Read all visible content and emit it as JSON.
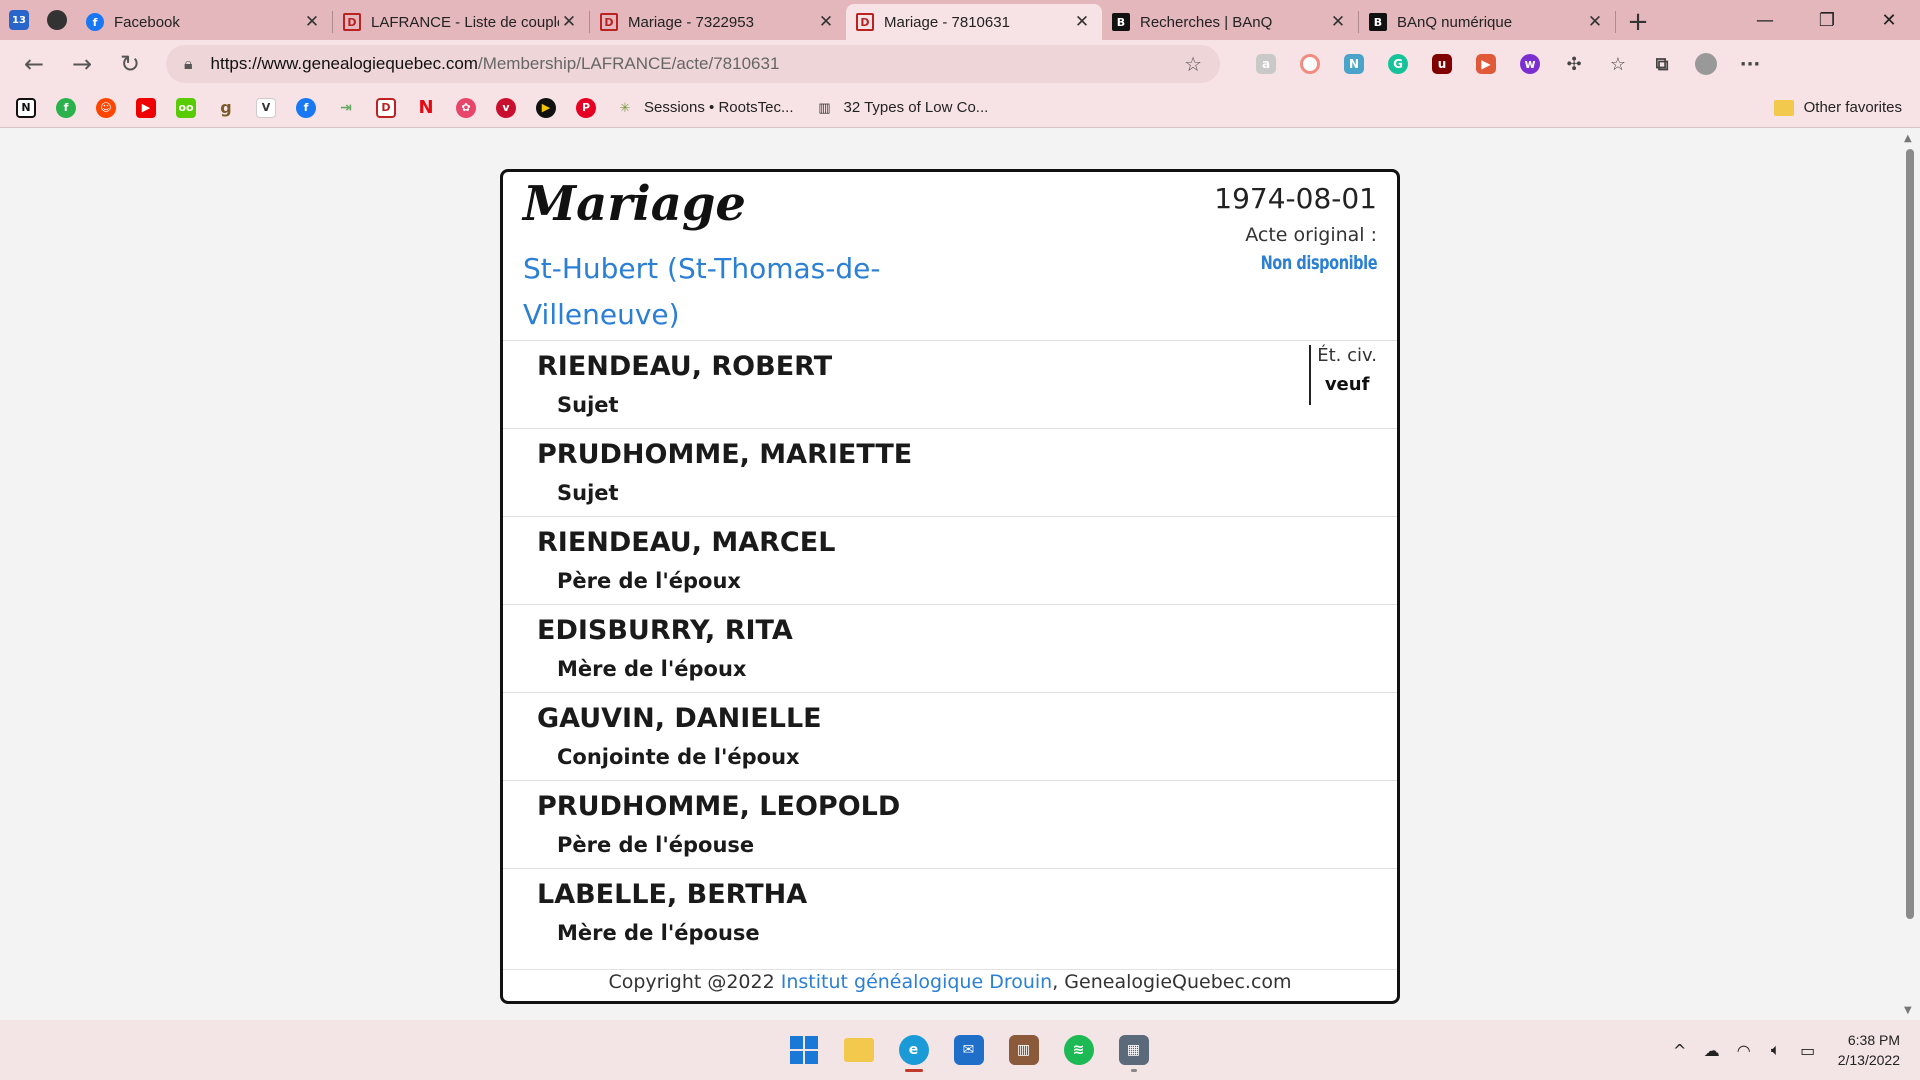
{
  "browser": {
    "pinned_tabs": [
      "13",
      ""
    ],
    "tabs": [
      {
        "title": "Facebook",
        "favicon": "facebook-icon",
        "active": false
      },
      {
        "title": "LAFRANCE - Liste de couples",
        "favicon": "genealogie-icon",
        "active": false
      },
      {
        "title": "Mariage - 7322953",
        "favicon": "genealogie-icon",
        "active": false
      },
      {
        "title": "Mariage - 7810631",
        "favicon": "genealogie-icon",
        "active": true
      },
      {
        "title": "Recherches | BAnQ",
        "favicon": "banq-icon",
        "active": false
      },
      {
        "title": "BAnQ numérique",
        "favicon": "banq-icon",
        "active": false
      }
    ],
    "url_host": "https://www.genealogiequebec.com",
    "url_path": "/Membership/LAFRANCE/acte/7810631",
    "bookmarks": [
      {
        "label": "Sessions • RootsTec...",
        "icon": "rootstech-icon"
      },
      {
        "label": "32 Types of Low Co...",
        "icon": "banq-icon"
      }
    ],
    "other_favorites": "Other favorites"
  },
  "record": {
    "type": "Mariage",
    "place": "St-Hubert (St-Thomas-de-Villeneuve)",
    "date": "1974-08-01",
    "original_label": "Acte original :",
    "original_value": "Non disponible",
    "persons": [
      {
        "name": "RIENDEAU, ROBERT",
        "role": "Sujet",
        "civ_label": "Ét. civ.",
        "civ_value": "veuf"
      },
      {
        "name": "PRUDHOMME, MARIETTE",
        "role": "Sujet"
      },
      {
        "name": "RIENDEAU, MARCEL",
        "role": "Père de l'époux"
      },
      {
        "name": "EDISBURRY, RITA",
        "role": "Mère de l'époux"
      },
      {
        "name": "GAUVIN, DANIELLE",
        "role": "Conjointe de l'époux"
      },
      {
        "name": "PRUDHOMME, LEOPOLD",
        "role": "Père de l'épouse"
      },
      {
        "name": "LABELLE, BERTHA",
        "role": "Mère de l'épouse"
      }
    ],
    "footer": {
      "prefix": "Copyright @2022 ",
      "link": "Institut généalogique Drouin",
      "suffix": ", GenealogieQuebec.com"
    }
  },
  "taskbar": {
    "time": "6:38 PM",
    "date": "2/13/2022"
  },
  "colors": {
    "accent_blue": "#2b7fd4",
    "tabbar": "#e3b7bc",
    "toolbar": "#f7e3e5"
  }
}
